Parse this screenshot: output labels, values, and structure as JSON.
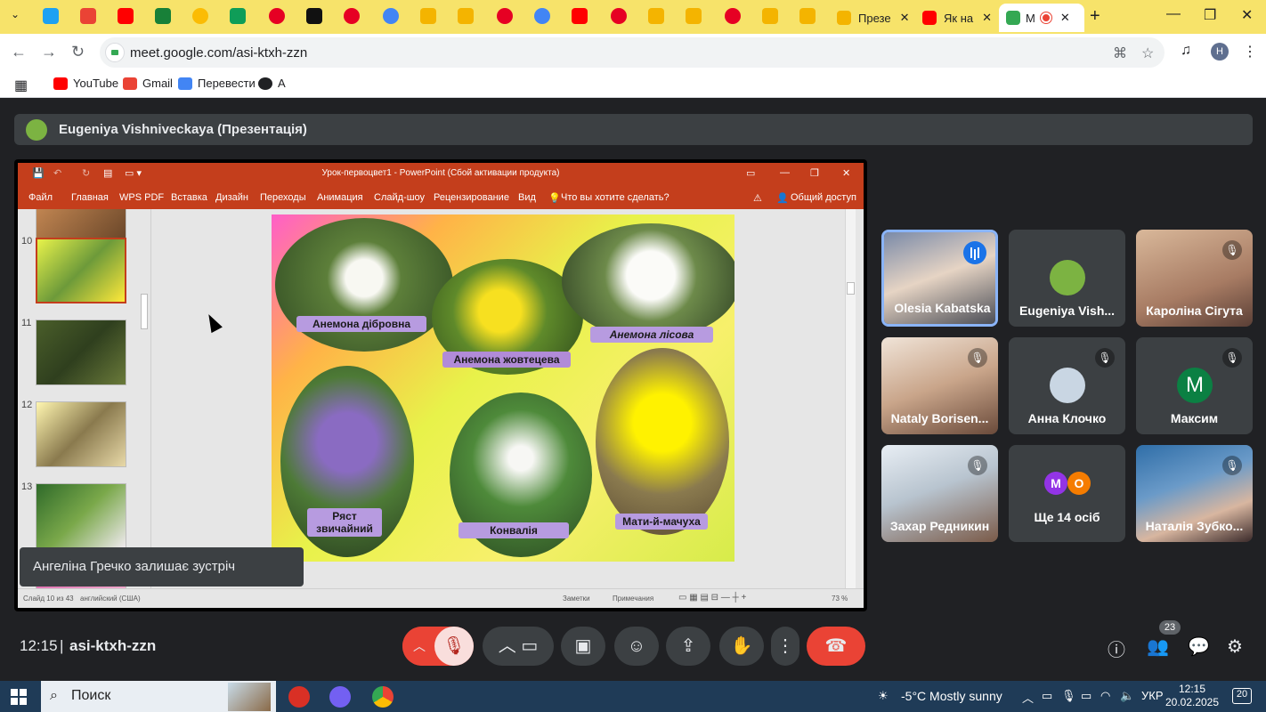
{
  "browser": {
    "tabs": [
      {
        "label": "Презе"
      },
      {
        "label": "Як на"
      },
      {
        "label": "М"
      }
    ],
    "url": "meet.google.com/asi-ktxh-zzn",
    "bookmarks": [
      {
        "label": "YouTube"
      },
      {
        "label": "Gmail"
      },
      {
        "label": "Перевести"
      },
      {
        "label": "A"
      }
    ]
  },
  "meet": {
    "presenter": "Eugeniya Vishniveckaya (Презентація)",
    "toast": "Ангеліна Гречко залишає зустріч",
    "time": "12:15",
    "separator": "|",
    "meeting_code": "asi-ktxh-zzn",
    "people_count": "23",
    "participants": [
      {
        "name": "Olesia Kabatska",
        "speaking": true
      },
      {
        "name": "Eugeniya Vish...",
        "muted": false
      },
      {
        "name": "Кароліна Сігута",
        "muted": true
      },
      {
        "name": "Nataly Borisen...",
        "muted": true
      },
      {
        "name": "Анна Клочко",
        "muted": true
      },
      {
        "name": "Максим",
        "muted": true,
        "initial": "M"
      },
      {
        "name": "Захар Редникин",
        "muted": true
      },
      {
        "name": "Ще 14 осіб",
        "initials": [
          "M",
          "O"
        ]
      },
      {
        "name": "Наталія Зубко...",
        "muted": true
      }
    ],
    "colors": {
      "accent": "#8ab4f8",
      "hangup": "#ea4335",
      "tile": "#3c4043"
    }
  },
  "powerpoint": {
    "window_title": "Урок-первоцвет1 - PowerPoint (Сбой активации продукта)",
    "ribbon_tabs": [
      "Файл",
      "Главная",
      "WPS PDF",
      "Вставка",
      "Дизайн",
      "Переходы",
      "Анимация",
      "Слайд-шоу",
      "Рецензирование",
      "Вид"
    ],
    "tell_me": "Что вы хотите сделать?",
    "share": "Общий доступ",
    "slide_numbers": [
      "10",
      "11",
      "12",
      "13"
    ],
    "slide_labels": {
      "l1": "Анемона дібровна",
      "l2": "Анемона жовтецева",
      "l3": "Анемона лісова",
      "l4": "Ряст звичайний",
      "l5": "Конвалія",
      "l6": "Мати-й-мачуха"
    },
    "status_left": "Слайд 10 из 43",
    "status_lang": "английский (США)",
    "status_notes": "Заметки",
    "status_comments": "Примечания",
    "zoom": "73 %"
  },
  "taskbar": {
    "search_placeholder": "Поиск",
    "weather": "-5°C  Mostly sunny",
    "lang": "УКР",
    "clock_time": "12:15",
    "clock_date": "20.02.2025",
    "notifications": "20"
  }
}
